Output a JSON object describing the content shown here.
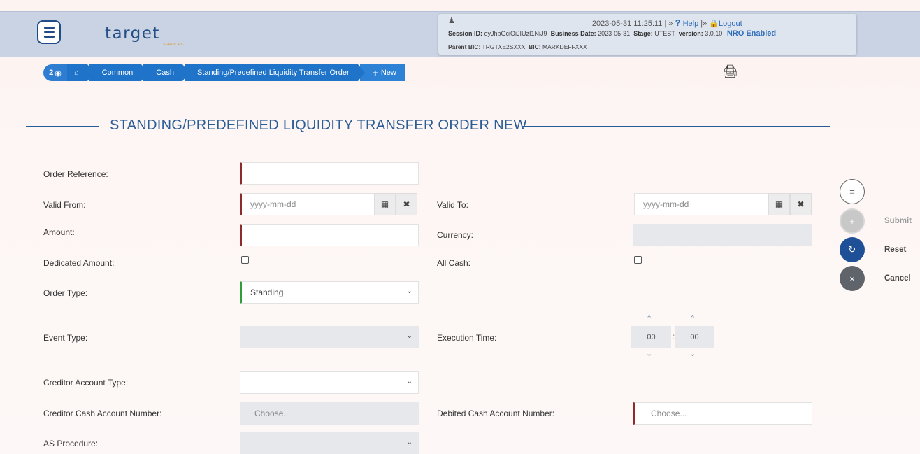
{
  "header": {
    "logo": "target",
    "logo_sub": "SERVICES",
    "timestamp": "| 2023-05-31 11:25:11 | »",
    "help": "Help",
    "logout_sep": "|»",
    "logout": "Logout",
    "session_label": "Session ID:",
    "session_id": "eyJhbGciOiJIUzI1NiJ9",
    "business_date_label": "Business Date:",
    "business_date": "2023-05-31",
    "stage_label": "Stage:",
    "stage": "UTEST",
    "version_label": "version:",
    "version": "3.0.10",
    "nro": "NRO Enabled",
    "parent_bic_label": "Parent BIC:",
    "parent_bic": "TRGTXE2SXXX",
    "bic_label": "BIC:",
    "bic": "MARKDEFFXXX"
  },
  "breadcrumb": {
    "badge": "2",
    "items": [
      "Common",
      "Cash",
      "Standing/Predefined Liquidity Transfer Order"
    ],
    "new": "New"
  },
  "title": "STANDING/PREDEFINED LIQUIDITY TRANSFER ORDER NEW",
  "form": {
    "order_reference": "Order Reference:",
    "valid_from": "Valid From:",
    "valid_from_placeholder": "yyyy-mm-dd",
    "valid_to": "Valid To:",
    "valid_to_placeholder": "yyyy-mm-dd",
    "amount": "Amount:",
    "currency": "Currency:",
    "dedicated_amount": "Dedicated Amount:",
    "all_cash": "All Cash:",
    "order_type": "Order Type:",
    "order_type_value": "Standing",
    "event_type": "Event Type:",
    "execution_time": "Execution Time:",
    "hours": "00",
    "minutes": "00",
    "time_sep": ":",
    "creditor_account_type": "Creditor Account Type:",
    "creditor_cash_account": "Creditor Cash Account Number:",
    "creditor_choose": "Choose...",
    "debited_cash_account": "Debited Cash Account Number:",
    "debited_choose": "Choose...",
    "as_procedure": "AS Procedure:"
  },
  "actions": {
    "submit": "Submit",
    "reset": "Reset",
    "cancel": "Cancel"
  },
  "colors": {
    "primary": "#1f73c8",
    "required": "#8d2a2a",
    "valid": "#2e9d3a",
    "title": "#2a5c96"
  }
}
